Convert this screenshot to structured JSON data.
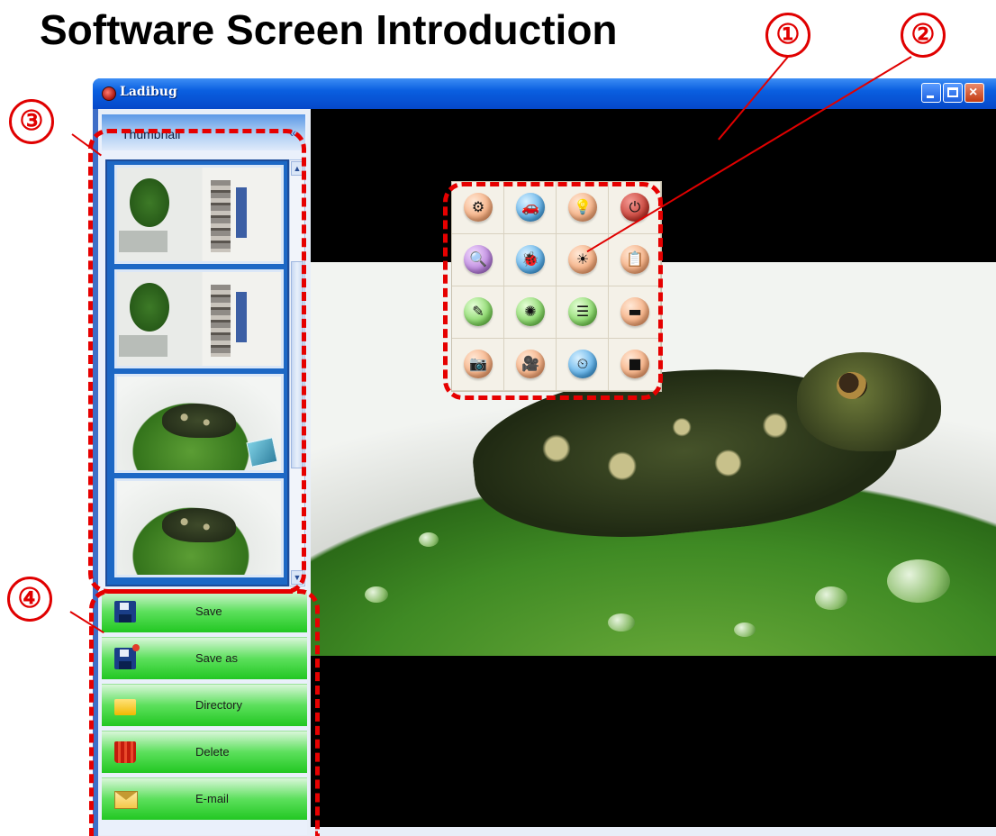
{
  "page": {
    "title": "Software Screen Introduction"
  },
  "callouts": [
    "①",
    "②",
    "③",
    "④"
  ],
  "window": {
    "title": "Ladibug",
    "controls": [
      "minimize-icon",
      "maximize-icon",
      "close-icon"
    ]
  },
  "sidebar": {
    "thumbnail_header": "Thumbnail",
    "collapse_icon": "double-chevron-left-icon",
    "thumbnails": [
      {
        "kind": "document"
      },
      {
        "kind": "document"
      },
      {
        "kind": "frog",
        "badge": "image-icon"
      },
      {
        "kind": "frog"
      }
    ],
    "actions": [
      {
        "label": "Save",
        "icon": "floppy-disk-icon"
      },
      {
        "label": "Save as",
        "icon": "floppy-disk-star-icon"
      },
      {
        "label": "Directory",
        "icon": "folder-icon"
      },
      {
        "label": "Delete",
        "icon": "trash-icon"
      },
      {
        "label": "E-mail",
        "icon": "envelope-icon"
      }
    ]
  },
  "toolbar": {
    "buttons": [
      {
        "icon": "settings-magnifier-icon",
        "glyph": "⚙"
      },
      {
        "icon": "car-icon",
        "glyph": "🚗"
      },
      {
        "icon": "lamp-icon",
        "glyph": "💡"
      },
      {
        "icon": "power-icon",
        "glyph": "⏻"
      },
      {
        "icon": "zoom-in-icon",
        "glyph": "🔍"
      },
      {
        "icon": "ladybug-icon",
        "glyph": "🐞"
      },
      {
        "icon": "brightness-icon",
        "glyph": "☀"
      },
      {
        "icon": "clipboard-icon",
        "glyph": "📋"
      },
      {
        "icon": "draw-icon",
        "glyph": "✎"
      },
      {
        "icon": "focus-icon",
        "glyph": "✺"
      },
      {
        "icon": "document-icon",
        "glyph": "☰"
      },
      {
        "icon": "window-icon",
        "glyph": "▬"
      },
      {
        "icon": "camera-icon",
        "glyph": "📷"
      },
      {
        "icon": "video-camera-icon",
        "glyph": "🎥"
      },
      {
        "icon": "timer-icon",
        "glyph": "⏲"
      },
      {
        "icon": "stop-icon",
        "glyph": "■"
      }
    ]
  },
  "colors": {
    "callout": "#e00000",
    "action_green": "#22c722",
    "titlebar_blue": "#0a5fe0"
  }
}
